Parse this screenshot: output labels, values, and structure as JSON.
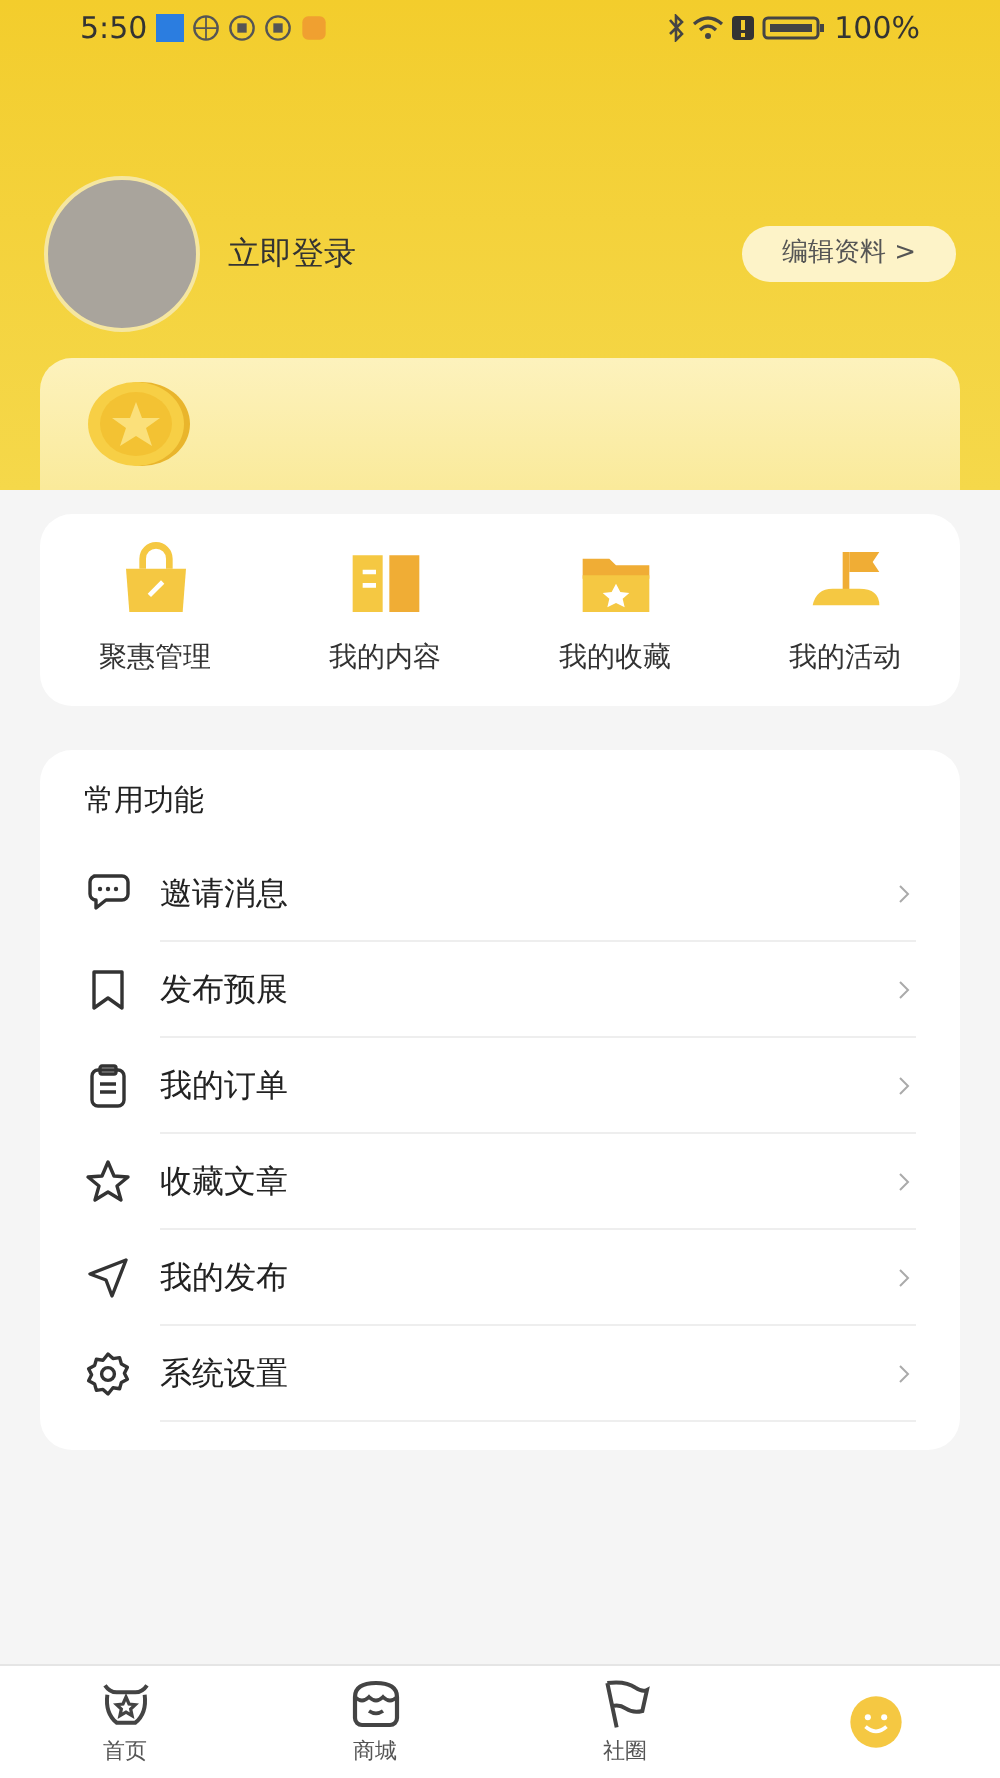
{
  "status_bar": {
    "time": "5:50",
    "battery": "100%"
  },
  "profile": {
    "login": "立即登录",
    "edit_button": "编辑资料 >"
  },
  "shortcuts": [
    {
      "label": "聚惠管理"
    },
    {
      "label": "我的内容"
    },
    {
      "label": "我的收藏"
    },
    {
      "label": "我的活动"
    }
  ],
  "common": {
    "title": "常用功能",
    "items": [
      {
        "label": "邀请消息"
      },
      {
        "label": "发布预展"
      },
      {
        "label": "我的订单"
      },
      {
        "label": "收藏文章"
      },
      {
        "label": "我的发布"
      },
      {
        "label": "系统设置"
      }
    ]
  },
  "tab_bar": [
    {
      "label": "首页",
      "selected": false
    },
    {
      "label": "商城",
      "selected": false
    },
    {
      "label": "社圈",
      "selected": false
    },
    {
      "selected": true
    }
  ]
}
